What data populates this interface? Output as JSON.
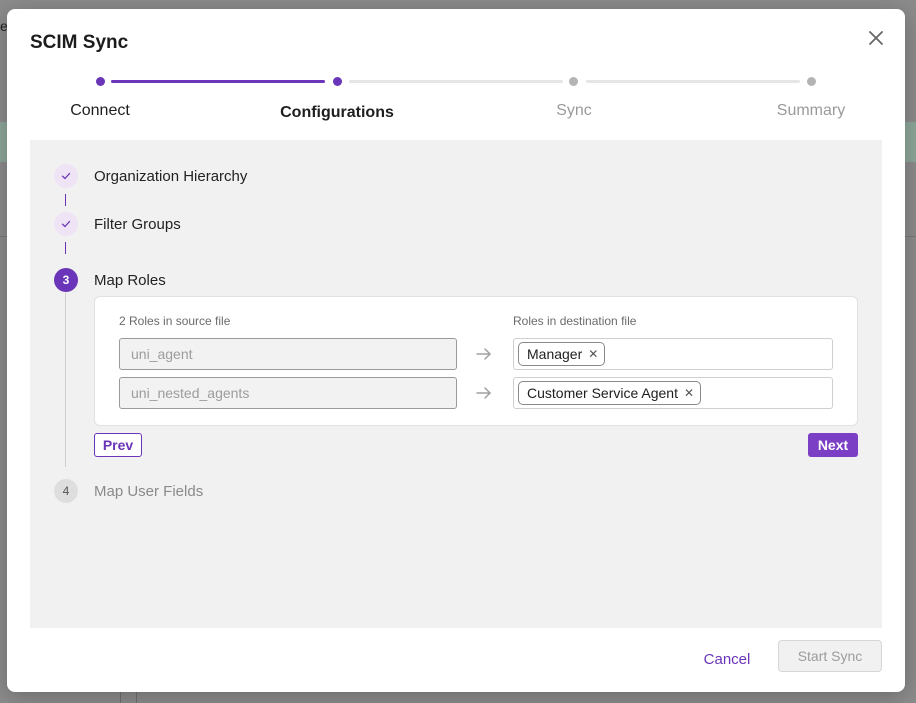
{
  "background": {
    "fragment_char": "e"
  },
  "modal": {
    "title": "SCIM Sync",
    "close_icon": "close-icon"
  },
  "stepper": {
    "steps": [
      {
        "label": "Connect",
        "state": "done"
      },
      {
        "label": "Configurations",
        "state": "current"
      },
      {
        "label": "Sync",
        "state": "pending"
      },
      {
        "label": "Summary",
        "state": "pending"
      }
    ]
  },
  "sub_steps": [
    {
      "marker": "check-icon",
      "label": "Organization Hierarchy",
      "state": "done"
    },
    {
      "marker": "check-icon",
      "label": "Filter Groups",
      "state": "done"
    },
    {
      "marker": "3",
      "label": "Map Roles",
      "state": "current"
    },
    {
      "marker": "4",
      "label": "Map User Fields",
      "state": "pending"
    }
  ],
  "map_roles": {
    "source_header": "2 Roles in source file",
    "dest_header": "Roles in destination file",
    "rows": [
      {
        "source": "uni_agent",
        "dest_tags": [
          "Manager"
        ]
      },
      {
        "source": "uni_nested_agents",
        "dest_tags": [
          "Customer Service Agent"
        ]
      }
    ],
    "prev_label": "Prev",
    "next_label": "Next"
  },
  "footer": {
    "cancel_label": "Cancel",
    "start_label": "Start Sync"
  },
  "colors": {
    "accent": "#6a35b8",
    "panel_bg": "#f1f1f1"
  }
}
